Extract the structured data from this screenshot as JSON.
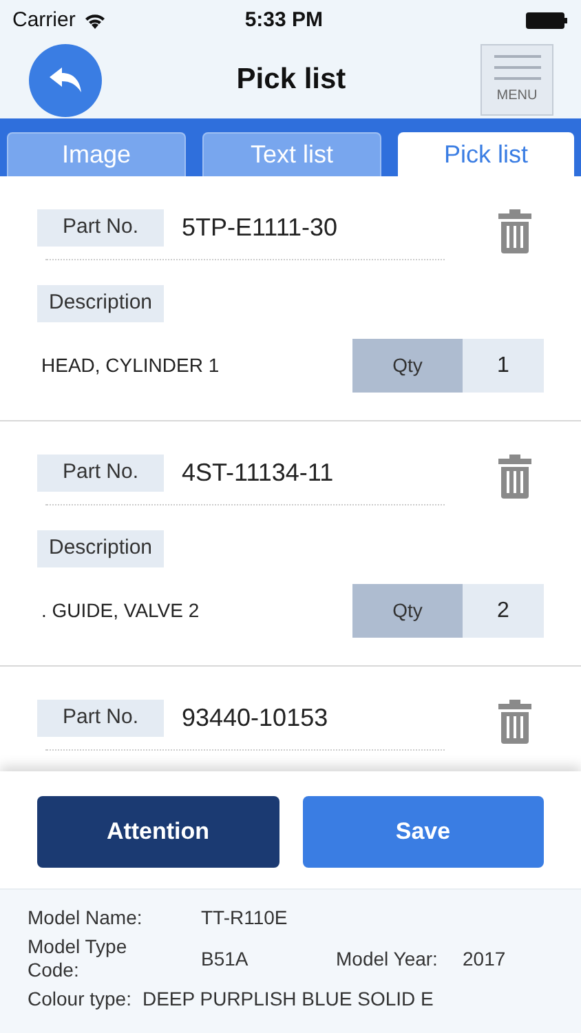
{
  "status_bar": {
    "carrier": "Carrier",
    "time": "5:33 PM"
  },
  "header": {
    "title": "Pick list",
    "menu_label": "MENU"
  },
  "tabs": [
    {
      "label": "Image",
      "selected": false
    },
    {
      "label": "Text list",
      "selected": false
    },
    {
      "label": "Pick list",
      "selected": true
    }
  ],
  "items": [
    {
      "part_label": "Part No.",
      "part_no": "5TP-E1111-30",
      "description_label": "Description",
      "description": "HEAD, CYLINDER 1",
      "qty_label": "Qty",
      "qty": "1"
    },
    {
      "part_label": "Part No.",
      "part_no": "4ST-11134-11",
      "description_label": "Description",
      "description": ". GUIDE, VALVE 2",
      "qty_label": "Qty",
      "qty": "2"
    },
    {
      "part_label": "Part No.",
      "part_no": "93440-10153"
    }
  ],
  "buttons": [
    {
      "label": "Attention",
      "kind": "dark"
    },
    {
      "label": "Save",
      "kind": "primary"
    }
  ],
  "model_info": {
    "name_label": "Model Name:",
    "name": "TT-R110E",
    "type_label": "Model Type Code:",
    "type": "B51A",
    "year_label": "Model Year:",
    "year": "2017",
    "colour_label": "Colour type:",
    "colour": "DEEP PURPLISH BLUE SOLID E"
  }
}
